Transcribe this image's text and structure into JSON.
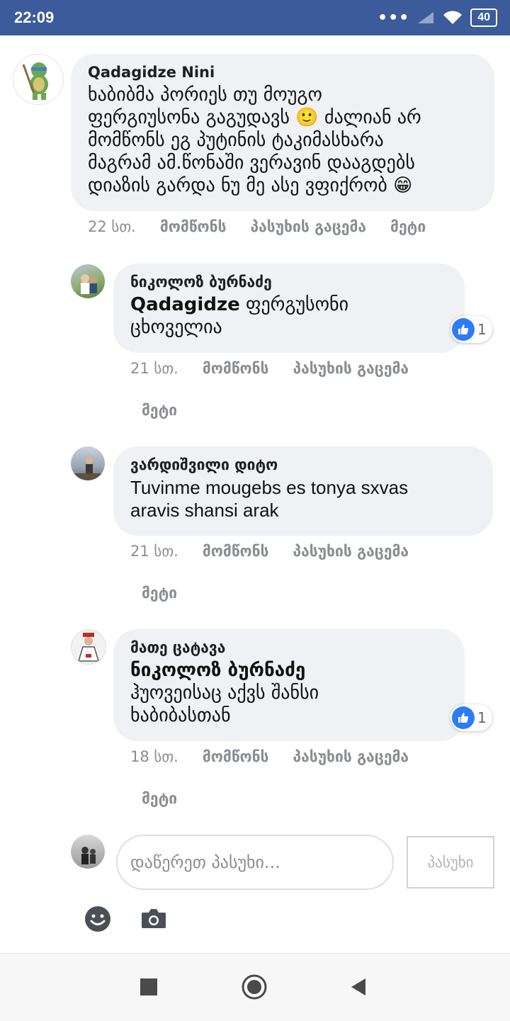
{
  "status_bar": {
    "time": "22:09",
    "battery": "40"
  },
  "comments": [
    {
      "author": "Qadagidze Nini",
      "text_lines": [
        "ხაბიბმა პორიეს თუ მოუგო",
        "ფერგიუსონა გაგუდავს 🙂 ძალიან არ",
        "მომწონს ეგ პუტინის ტაკიმასხარა",
        "მაგრამ ამ.წონაში ვერავინ დააგდებს",
        "დიაზის გარდა ნუ მე ასე ვფიქრობ 😁"
      ],
      "time": "22 სთ.",
      "like": "მომწონს",
      "reply": "პასუხის გაცემა",
      "more": "მეტი"
    },
    {
      "author": "ნიკოლოზ ბურნაძე",
      "mention": "Qadagidze",
      "text_lines": [
        " ფერგუსონი",
        "ცხოველია"
      ],
      "time": "21 სთ.",
      "like": "მომწონს",
      "reply": "პასუხის გაცემა",
      "more": "მეტი",
      "reactions": "1"
    },
    {
      "author": "ვარდიშვილი დიტო",
      "text_lines": [
        "Tuvinme mougebs es tonya sxvas",
        "aravis shansi arak"
      ],
      "time": "21 სთ.",
      "like": "მომწონს",
      "reply": "პასუხის გაცემა",
      "more": "მეტი"
    },
    {
      "author": "მათე ცატავა",
      "mention": "ნიკოლოზ ბურნაძე",
      "text_lines": [
        "ჰუოვეისაც აქვს შანსი",
        "ხაბიბასთან"
      ],
      "time": "18 სთ.",
      "like": "მომწონს",
      "reply": "პასუხის გაცემა",
      "more": "მეტი",
      "reactions": "1"
    }
  ],
  "composer": {
    "placeholder": "დაწერეთ პასუხი...",
    "send_label": "პასუხი"
  },
  "colors": {
    "status_bar": "#3b5b9b",
    "like_blue": "#2d7cf6",
    "bubble": "#f0f1f4",
    "meta_text": "#8a8d91"
  }
}
